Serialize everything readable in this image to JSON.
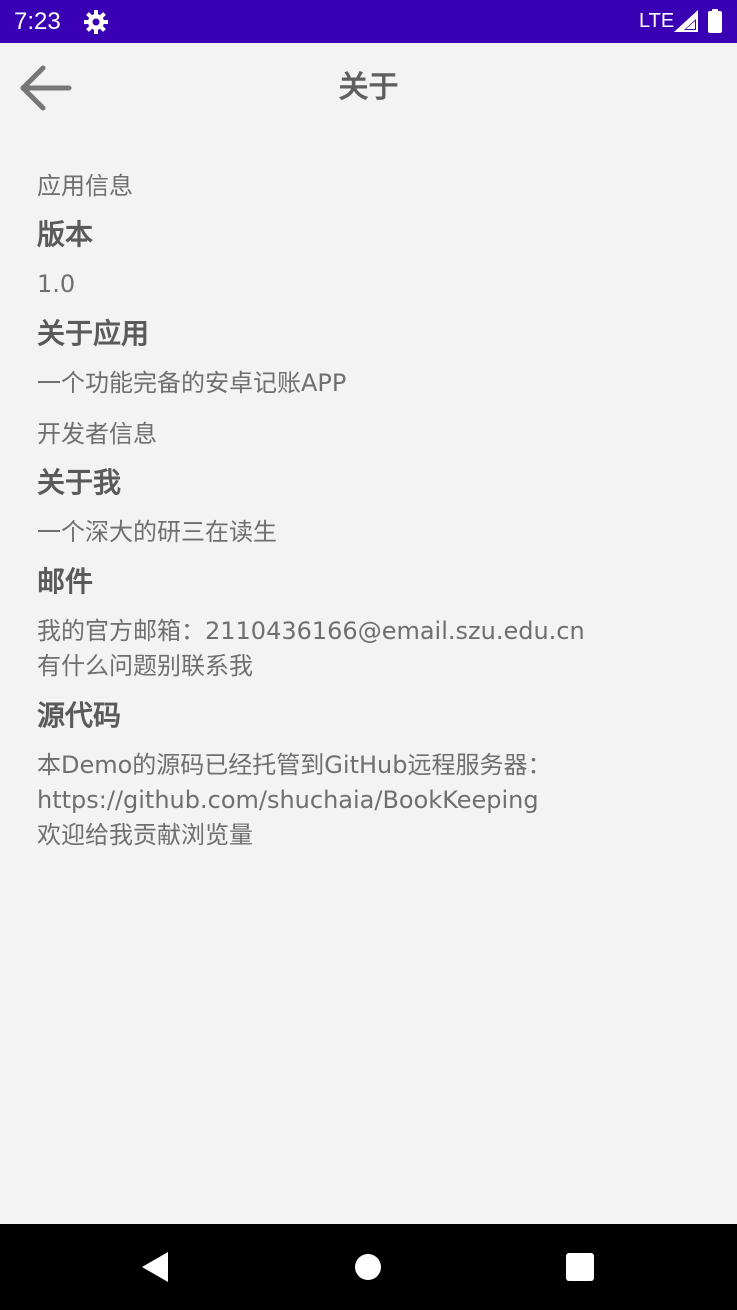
{
  "status_bar": {
    "time": "7:23",
    "network": "LTE",
    "background": "#3a00b3",
    "icons": [
      "gear-icon",
      "signal-icon",
      "battery-icon"
    ]
  },
  "app_bar": {
    "title": "关于",
    "back_icon": "arrow-left-icon"
  },
  "sections": {
    "app_info": {
      "category": "应用信息",
      "version_title": "版本",
      "version_value": "1.0",
      "about_app_title": "关于应用",
      "about_app_value": "一个功能完备的安卓记账APP"
    },
    "developer_info": {
      "category": "开发者信息",
      "about_me_title": "关于我",
      "about_me_value": "一个深大的研三在读生",
      "email_title": "邮件",
      "email_value": "我的官方邮箱：2110436166@email.szu.edu.cn\n有什么问题别联系我",
      "source_title": "源代码",
      "source_value": "本Demo的源码已经托管到GitHub远程服务器：\nhttps://github.com/shuchaia/BookKeeping\n欢迎给我贡献浏览量"
    }
  },
  "nav_bar": {
    "icons": [
      "nav-back-icon",
      "nav-home-icon",
      "nav-recent-icon"
    ]
  }
}
